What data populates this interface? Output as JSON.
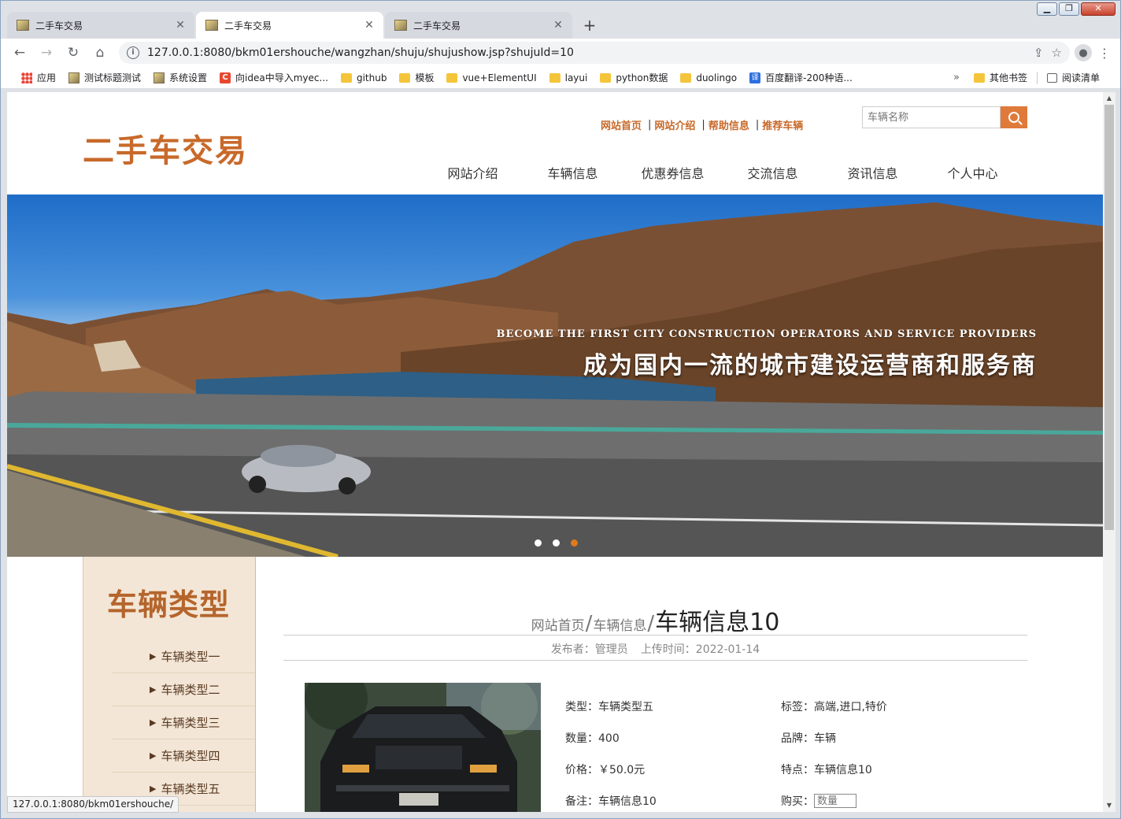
{
  "browser": {
    "tabs": [
      {
        "title": "二手车交易",
        "active": false
      },
      {
        "title": "二手车交易",
        "active": true
      },
      {
        "title": "二手车交易",
        "active": false
      }
    ],
    "new_tab_label": "+",
    "url": "127.0.0.1:8080/bkm01ershouche/wangzhan/shuju/shujushow.jsp?shujuId=10",
    "bookmarks": [
      {
        "label": "应用",
        "icon": "apps-icon"
      },
      {
        "label": "测试标题测试",
        "icon": "page-icon"
      },
      {
        "label": "系统设置",
        "icon": "page-icon"
      },
      {
        "label": "向idea中导入myec...",
        "icon": "csdn-icon"
      },
      {
        "label": "github",
        "icon": "folder-icon"
      },
      {
        "label": "模板",
        "icon": "folder-icon"
      },
      {
        "label": "vue+ElementUI",
        "icon": "folder-icon"
      },
      {
        "label": "layui",
        "icon": "folder-icon"
      },
      {
        "label": "python数据",
        "icon": "folder-icon"
      },
      {
        "label": "duolingo",
        "icon": "folder-icon"
      },
      {
        "label": "百度翻译-200种语...",
        "icon": "translate-icon"
      }
    ],
    "bookmarks_more": "»",
    "other_bookmarks": "其他书签",
    "reading_list": "阅读清单",
    "status_url": "127.0.0.1:8080/bkm01ershouche/"
  },
  "site": {
    "logo": "二手车交易",
    "toplinks": [
      "网站首页",
      "网站介绍",
      "帮助信息",
      "推荐车辆"
    ],
    "search_placeholder": "车辆名称",
    "nav": [
      "网站介绍",
      "车辆信息",
      "优惠券信息",
      "交流信息",
      "资讯信息",
      "个人中心"
    ],
    "banner": {
      "en": "BECOME THE FIRST CITY CONSTRUCTION OPERATORS AND SERVICE PROVIDERS",
      "cn": "成为国内一流的城市建设运营商和服务商",
      "active_slide": 3,
      "slide_count": 3
    },
    "sidebar": {
      "title": "车辆类型",
      "items": [
        "车辆类型一",
        "车辆类型二",
        "车辆类型三",
        "车辆类型四",
        "车辆类型五"
      ]
    },
    "breadcrumb": {
      "home": "网站首页",
      "section": "车辆信息",
      "current": "车辆信息10",
      "sep": "/"
    },
    "meta": {
      "publisher": "发布者：管理员",
      "upload_time": "上传时间：2022-01-14"
    },
    "details": [
      [
        {
          "text": "类型：车辆类型五"
        },
        {
          "text": "标签：高端,进口,特价"
        }
      ],
      [
        {
          "text": "数量：400"
        },
        {
          "text": "品牌：车辆"
        }
      ],
      [
        {
          "text": "价格：￥50.0元"
        },
        {
          "text": "特点：车辆信息10"
        }
      ],
      [
        {
          "text": "备注：车辆信息10"
        },
        {
          "text": "购买："
        }
      ]
    ],
    "qty_placeholder": "数量"
  },
  "colors": {
    "accent": "#c8692a",
    "search_button": "#e07a3a",
    "sidebar_bg": "#f3e6d6",
    "dot_active": "#e07a1a"
  }
}
